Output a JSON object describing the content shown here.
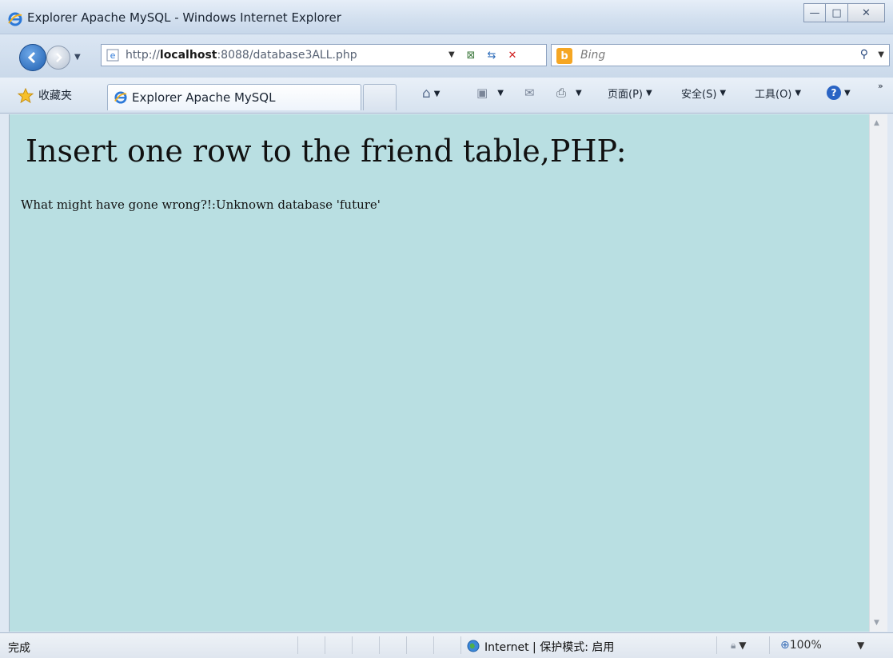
{
  "window": {
    "title": "Explorer Apache MySQL - Windows Internet Explorer",
    "buttons": {
      "minimize": "▭",
      "maximize": "□",
      "close": "☒"
    }
  },
  "address": {
    "url_prefix": "http://",
    "url_host": "localhost",
    "url_rest": ":8088/database3ALL.php",
    "search_engine": "b",
    "search_placeholder": "Bing"
  },
  "toolbar": {
    "favorites_label": "收藏夹",
    "tab_title": "Explorer Apache MySQL",
    "page_menu": "页面(P)",
    "safety_menu": "安全(S)",
    "tools_menu": "工具(O)",
    "help_icon": "help-icon",
    "chevron": "»"
  },
  "page": {
    "heading": "Insert one row to the friend table,PHP:",
    "message": "What might have gone wrong?!:Unknown database 'future'",
    "background": "#b9dfe2"
  },
  "status": {
    "text": "完成",
    "zone": "Internet | 保护模式: 启用",
    "zoom": "100%"
  }
}
